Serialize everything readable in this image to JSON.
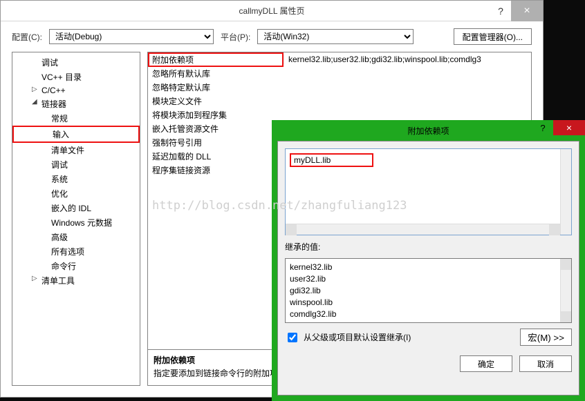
{
  "main": {
    "title": "callmyDLL 属性页",
    "cfg_label": "配置(C):",
    "plat_label": "平台(P):",
    "cfg_value": "活动(Debug)",
    "plat_value": "活动(Win32)",
    "mgr_button": "配置管理器(O)..."
  },
  "tree": [
    {
      "label": "调试",
      "level": 1
    },
    {
      "label": "VC++ 目录",
      "level": 1
    },
    {
      "label": "C/C++",
      "level": 1,
      "arrow": "▷"
    },
    {
      "label": "链接器",
      "level": 1,
      "arrow": "◢"
    },
    {
      "label": "常规",
      "level": 2
    },
    {
      "label": "输入",
      "level": 2,
      "selected": true,
      "redbox": true
    },
    {
      "label": "清单文件",
      "level": 2
    },
    {
      "label": "调试",
      "level": 2
    },
    {
      "label": "系统",
      "level": 2
    },
    {
      "label": "优化",
      "level": 2
    },
    {
      "label": "嵌入的 IDL",
      "level": 2
    },
    {
      "label": "Windows 元数据",
      "level": 2
    },
    {
      "label": "高级",
      "level": 2
    },
    {
      "label": "所有选项",
      "level": 2
    },
    {
      "label": "命令行",
      "level": 2
    },
    {
      "label": "清单工具",
      "level": 1,
      "arrow": "▷"
    }
  ],
  "props": [
    {
      "name": "附加依赖项",
      "val": "kernel32.lib;user32.lib;gdi32.lib;winspool.lib;comdlg3",
      "redbox": true
    },
    {
      "name": "忽略所有默认库",
      "val": ""
    },
    {
      "name": "忽略特定默认库",
      "val": ""
    },
    {
      "name": "模块定义文件",
      "val": ""
    },
    {
      "name": "将模块添加到程序集",
      "val": ""
    },
    {
      "name": "嵌入托管资源文件",
      "val": ""
    },
    {
      "name": "强制符号引用",
      "val": ""
    },
    {
      "name": "延迟加载的 DLL",
      "val": ""
    },
    {
      "name": "程序集链接资源",
      "val": ""
    }
  ],
  "desc": {
    "title": "附加依赖项",
    "text": "指定要添加到链接命令行的附加项。"
  },
  "sub": {
    "title": "附加依赖项",
    "entry": "myDLL.lib",
    "inherit_label": "继承的值:",
    "inherit_values": [
      "kernel32.lib",
      "user32.lib",
      "gdi32.lib",
      "winspool.lib",
      "comdlg32.lib"
    ],
    "chk_label": "从父级或项目默认设置继承(I)",
    "macro_btn": "宏(M) >>",
    "ok": "确定",
    "cancel": "取消"
  },
  "watermark": "http://blog.csdn.net/zhangfuliang123"
}
